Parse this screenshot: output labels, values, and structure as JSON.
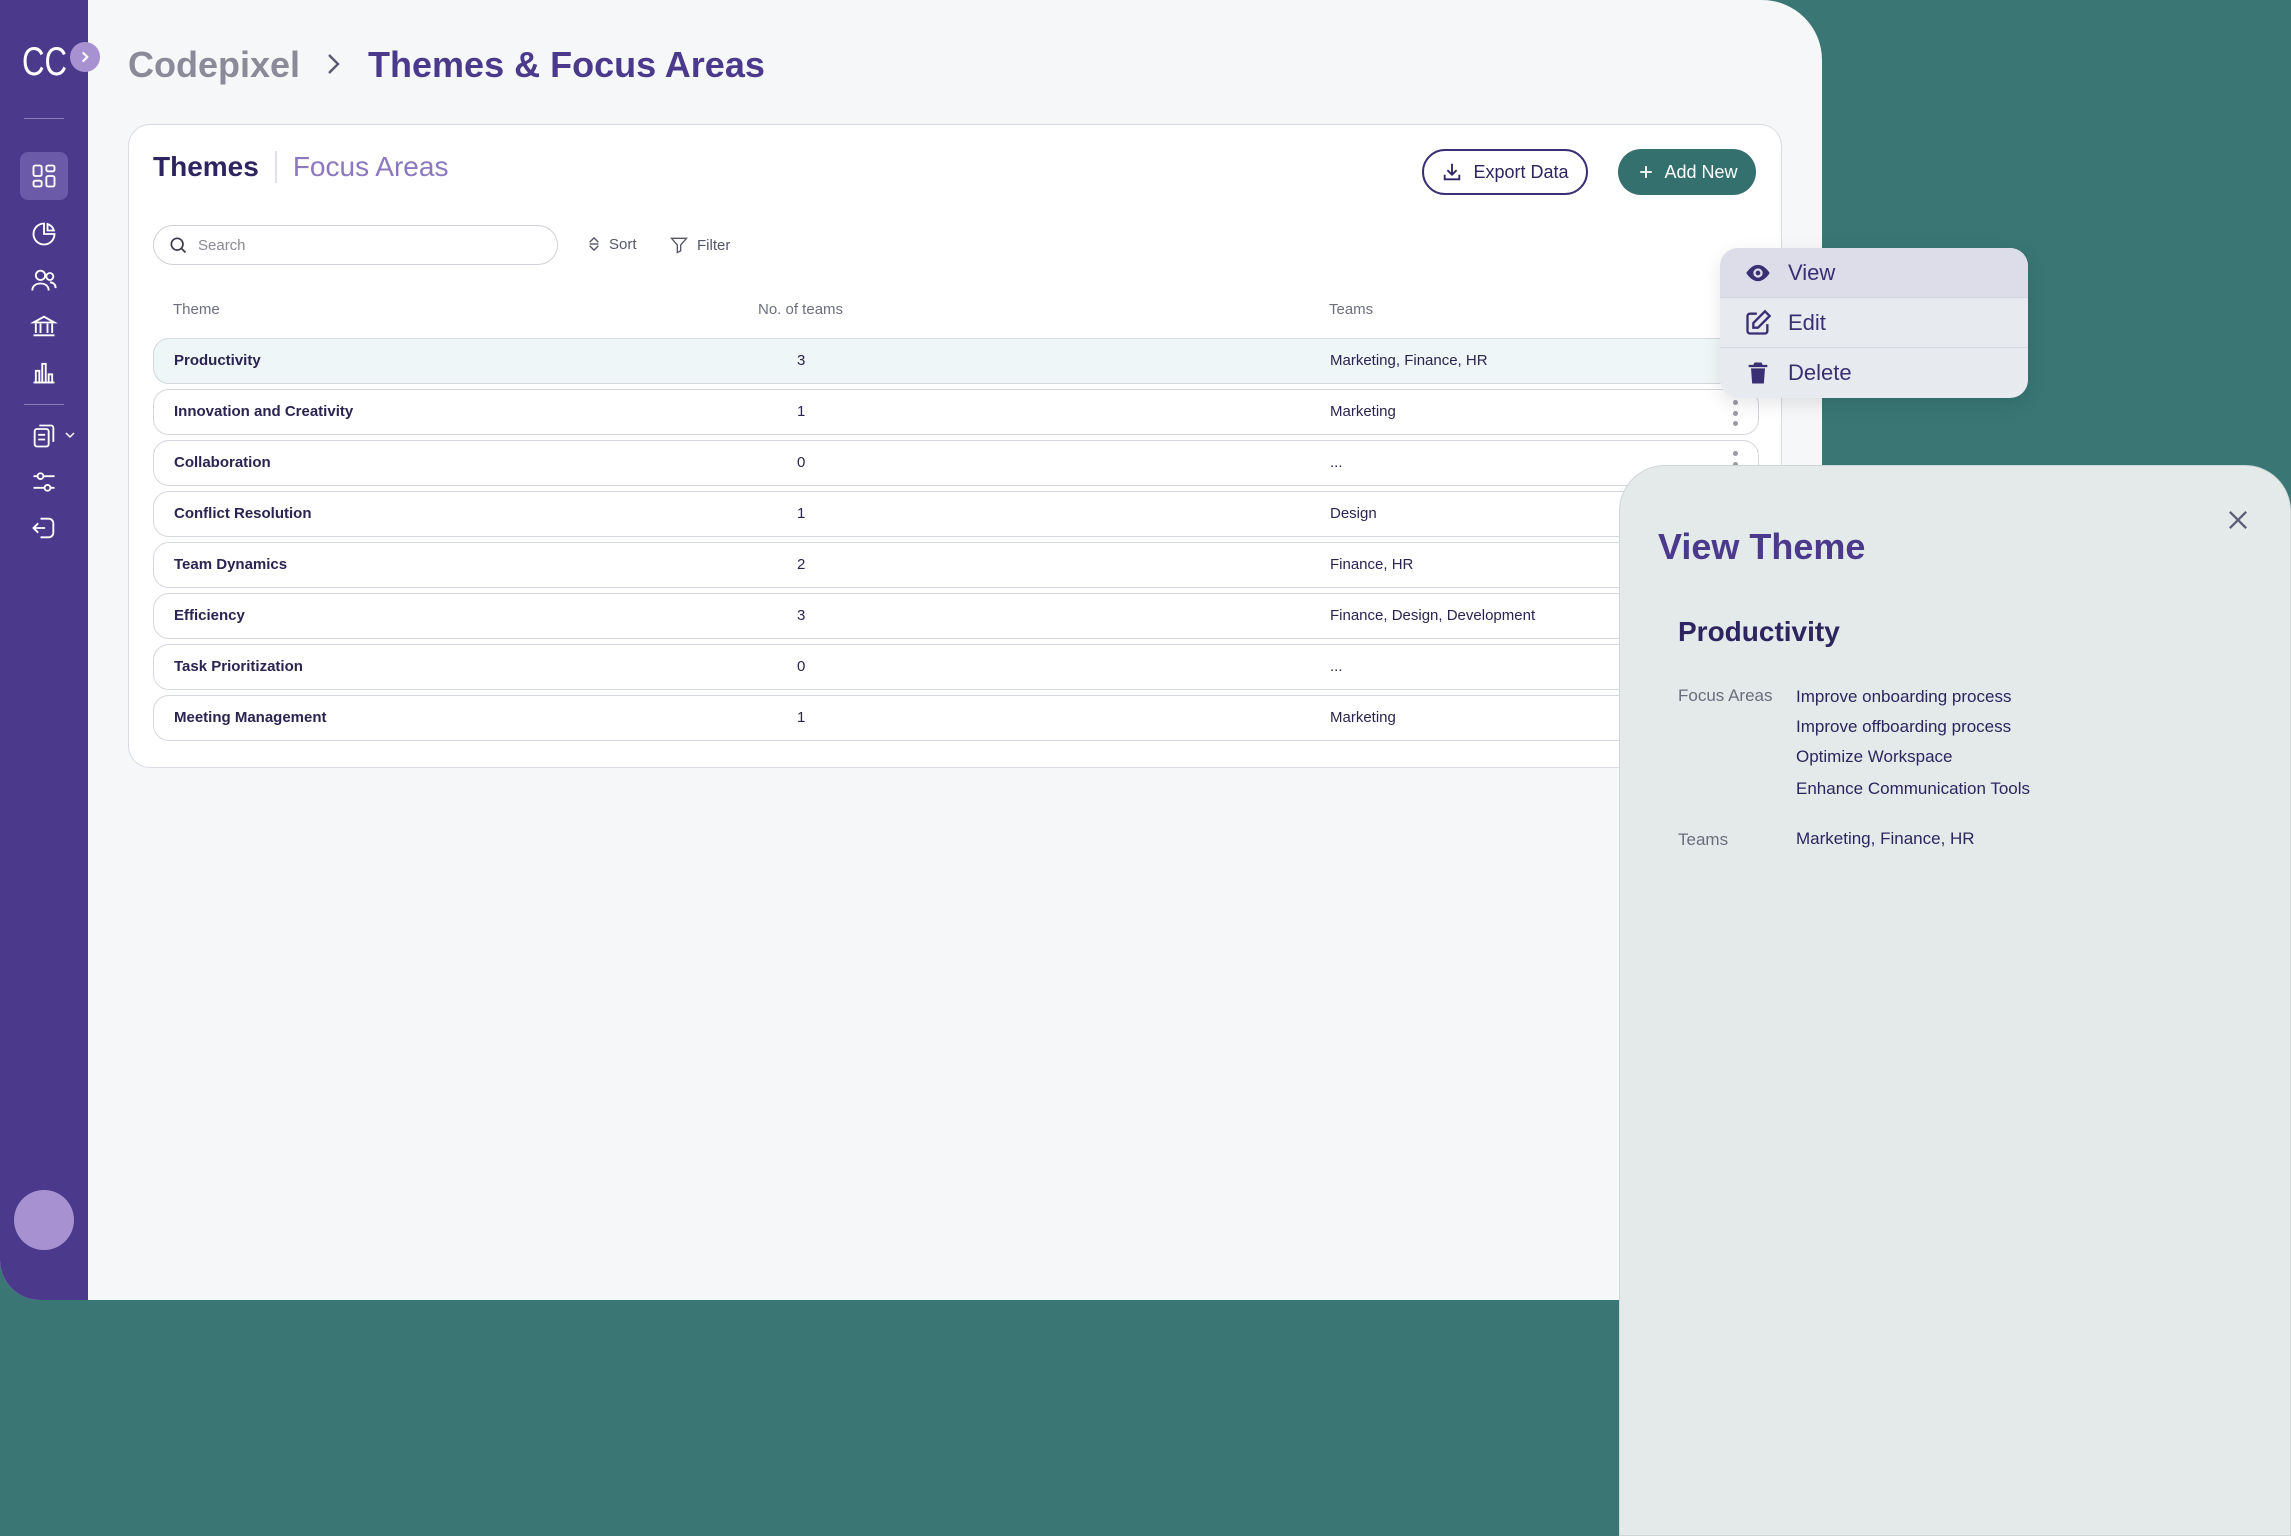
{
  "app": {
    "logo": "CC",
    "breadcrumb": {
      "root": "Codepixel",
      "current": "Themes & Focus Areas"
    }
  },
  "tabs": {
    "themes": "Themes",
    "focus_areas": "Focus Areas"
  },
  "toolbar": {
    "export_label": "Export Data",
    "add_label": "Add New",
    "search_placeholder": "Search",
    "sort_label": "Sort",
    "filter_label": "Filter"
  },
  "table": {
    "columns": {
      "theme": "Theme",
      "count": "No. of teams",
      "teams": "Teams"
    },
    "rows": [
      {
        "theme": "Productivity",
        "count": "3",
        "teams": "Marketing, Finance, HR"
      },
      {
        "theme": "Innovation and Creativity",
        "count": "1",
        "teams": "Marketing"
      },
      {
        "theme": "Collaboration",
        "count": "0",
        "teams": "..."
      },
      {
        "theme": "Conflict Resolution",
        "count": "1",
        "teams": "Design"
      },
      {
        "theme": "Team Dynamics",
        "count": "2",
        "teams": "Finance, HR"
      },
      {
        "theme": "Efficiency",
        "count": "3",
        "teams": "Finance, Design, Development"
      },
      {
        "theme": "Task Prioritization",
        "count": "0",
        "teams": "..."
      },
      {
        "theme": "Meeting Management",
        "count": "1",
        "teams": "Marketing"
      }
    ]
  },
  "context_menu": {
    "view": "View",
    "edit": "Edit",
    "delete": "Delete"
  },
  "panel": {
    "title": "View Theme",
    "theme_name": "Productivity",
    "focus_areas_label": "Focus Areas",
    "focus_areas": [
      "Improve onboarding process",
      "Improve offboarding process",
      "Optimize Workspace",
      "Enhance Communication Tools"
    ],
    "teams_label": "Teams",
    "teams_value": "Marketing, Finance, HR"
  },
  "colors": {
    "background": "#397674",
    "sidebar": "#4b3a8c",
    "accent": "#33706e",
    "title": "#4b3a8c"
  },
  "icons": {
    "sidebar": [
      "dashboard-icon",
      "chart-pie-icon",
      "users-icon",
      "bank-icon",
      "bar-chart-icon",
      "documents-icon",
      "sliders-icon",
      "logout-icon"
    ]
  }
}
